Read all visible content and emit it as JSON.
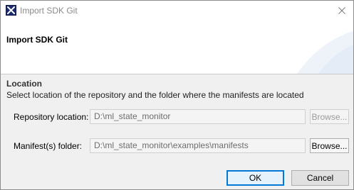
{
  "window": {
    "title": "Import SDK Git"
  },
  "banner": {
    "title": "Import SDK Git"
  },
  "section": {
    "title": "Location",
    "description": "Select location of the repository and the folder where the manifests are located"
  },
  "form": {
    "repository": {
      "label": "Repository location:",
      "value": "D:\\ml_state_monitor",
      "browse_label": "Browse...",
      "browse_enabled": false
    },
    "manifest": {
      "label": "Manifest(s) folder:",
      "value": "D:\\ml_state_monitor\\examples\\manifests",
      "browse_label": "Browse...",
      "browse_enabled": true
    }
  },
  "buttons": {
    "ok_label": "OK",
    "cancel_label": "Cancel"
  },
  "colors": {
    "accent": "#0078d7",
    "app_icon": "#1a2a6c",
    "dialog_body": "#f0f0f0"
  }
}
